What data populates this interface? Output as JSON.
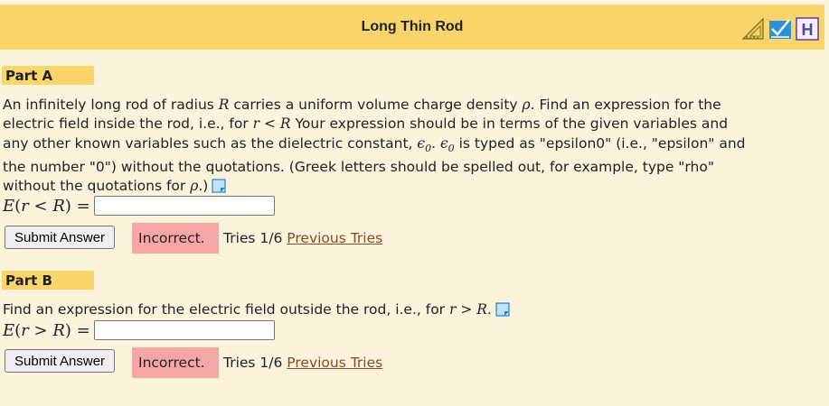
{
  "header": {
    "title": "Long Thin Rod"
  },
  "icons": [
    "ruler-triangle-icon",
    "blue-check-icon",
    "hint-h-icon",
    "note-icon"
  ],
  "colors": {
    "title_bar": "#f9d56b",
    "background": "#fbf3dc",
    "incorrect_badge": "#f6a6a6",
    "link": "#8a4b1e"
  },
  "part_a": {
    "header": "Part A",
    "line1_pre": "An infinitely long rod of radius ",
    "line1_R": "R",
    "line1_mid": " carries a uniform volume charge density ",
    "line1_rho": "ρ",
    "line1_post": ". Find an expression for the",
    "line2_pre": "electric field inside the rod, i.e., for ",
    "line2_r": "r",
    "line2_lt": " < ",
    "line2_R": "R",
    "line2_post": " Your expression should be in terms of the given variables and",
    "line3_pre": "any other known variables such as the dielectric constant, ",
    "line3_eps1": "ϵ",
    "line3_sub1": "0",
    "line3_dot": ". ",
    "line3_eps2": "ϵ",
    "line3_sub2": "0",
    "line3_post": " is typed as \"epsilon0\" (i.e., \"epsilon\" and",
    "line4": "the number \"0\") without the quotations. (Greek letters should be spelled out, for example, type \"rho\"",
    "line5_pre": "without the quotations for ",
    "line5_rho": "ρ",
    "line5_post": ".)",
    "answer_label_E": "E",
    "answer_label_open": "(",
    "answer_label_r": "r",
    "answer_label_op": " < ",
    "answer_label_R": "R",
    "answer_label_close": ") =",
    "input_value": "",
    "submit_label": "Submit Answer",
    "status": "Incorrect.",
    "tries": "Tries 1/6",
    "previous_tries": "Previous Tries"
  },
  "part_b": {
    "header": "Part B",
    "text_pre": "Find an expression for the electric field outside the rod, i.e., for ",
    "text_r": "r",
    "text_op": " > ",
    "text_R": "R",
    "text_post": ".",
    "answer_label_E": "E",
    "answer_label_open": "(",
    "answer_label_r": "r",
    "answer_label_op": " > ",
    "answer_label_R": "R",
    "answer_label_close": ") =",
    "input_value": "",
    "submit_label": "Submit Answer",
    "status": "Incorrect.",
    "tries": "Tries 1/6",
    "previous_tries": "Previous Tries"
  }
}
